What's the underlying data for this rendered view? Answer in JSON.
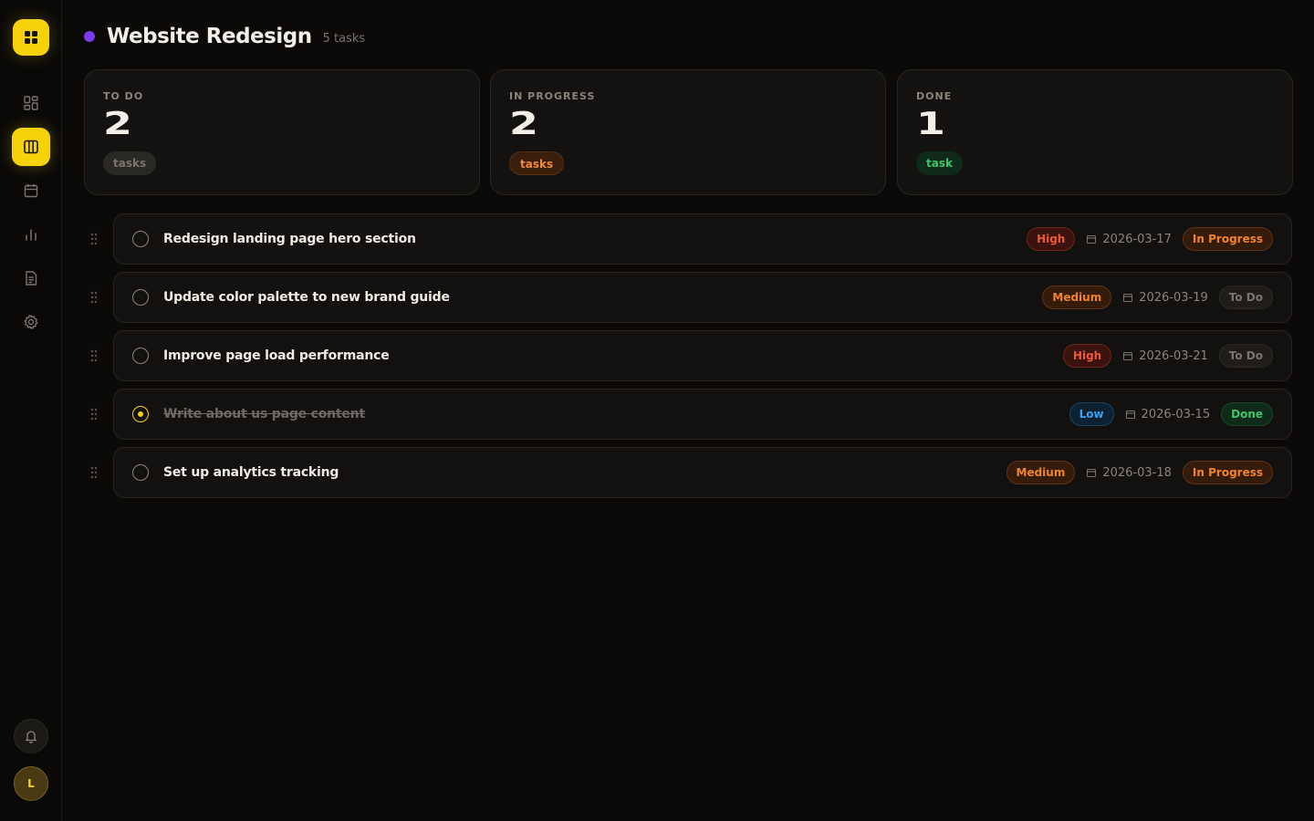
{
  "project": {
    "title": "Website Redesign",
    "task_count": "5 tasks",
    "dot_color": "#7c3aed"
  },
  "sidebar": {
    "logo_icon": "grid-icon",
    "items": [
      {
        "name": "dashboard-icon",
        "active": false
      },
      {
        "name": "board-icon",
        "active": true
      },
      {
        "name": "calendar-icon",
        "active": false
      },
      {
        "name": "chart-icon",
        "active": false
      },
      {
        "name": "document-icon",
        "active": false
      },
      {
        "name": "gear-icon",
        "active": false
      }
    ],
    "avatar_initial": "L"
  },
  "summary": [
    {
      "label": "TO DO",
      "value": "2",
      "unit": "tasks",
      "style": "gray"
    },
    {
      "label": "IN PROGRESS",
      "value": "2",
      "unit": "tasks",
      "style": "orange"
    },
    {
      "label": "DONE",
      "value": "1",
      "unit": "task",
      "style": "green"
    }
  ],
  "tasks": [
    {
      "title": "Redesign landing page hero section",
      "priority": "High",
      "date": "2026-03-17",
      "status": "In Progress",
      "done": false
    },
    {
      "title": "Update color palette to new brand guide",
      "priority": "Medium",
      "date": "2026-03-19",
      "status": "To Do",
      "done": false
    },
    {
      "title": "Improve page load performance",
      "priority": "High",
      "date": "2026-03-21",
      "status": "To Do",
      "done": false
    },
    {
      "title": "Write about us page content",
      "priority": "Low",
      "date": "2026-03-15",
      "status": "Done",
      "done": true
    },
    {
      "title": "Set up analytics tracking",
      "priority": "Medium",
      "date": "2026-03-18",
      "status": "In Progress",
      "done": false
    }
  ],
  "colors": {
    "accent": "#f5d20a",
    "background": "#0c0a08"
  }
}
